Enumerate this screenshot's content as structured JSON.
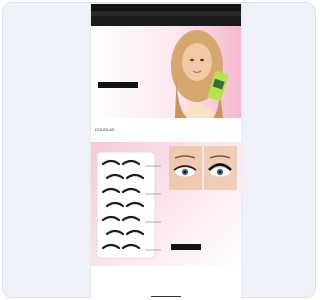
{
  "email": {
    "promo_bar": "",
    "subnav": [
      "",
      "",
      ""
    ],
    "logo": "",
    "hero": {
      "title": "",
      "subtitle": "",
      "button": ""
    },
    "brands": [
      "DOUGLAS",
      "",
      "",
      "",
      ""
    ],
    "lashes": {
      "title": "",
      "button": ""
    },
    "footer": {
      "headline": "",
      "subline": ""
    }
  },
  "colors": {
    "frame_bg": "#eef2f8",
    "accent_pink": "#f5b8cf",
    "dark": "#111111"
  }
}
